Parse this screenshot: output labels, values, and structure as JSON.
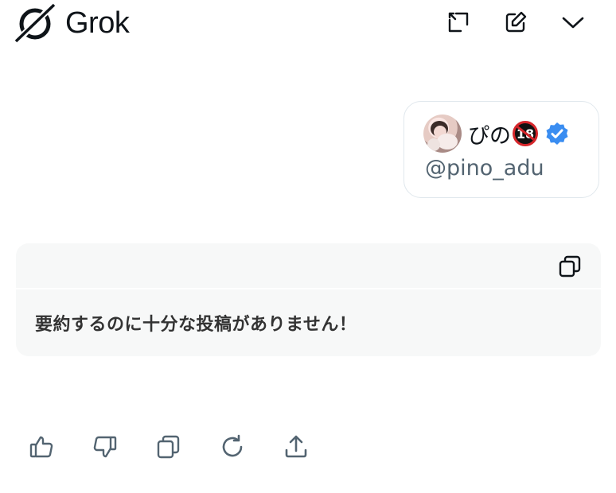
{
  "header": {
    "app_name": "Grok",
    "buttons": [
      {
        "name": "expand",
        "icon": "expand-icon"
      },
      {
        "name": "new-chat",
        "icon": "edit-icon"
      },
      {
        "name": "collapse",
        "icon": "chevron-down-icon"
      }
    ]
  },
  "user_card": {
    "display_name": "ぴの",
    "age_badge": "18",
    "handle": "@pino_adu",
    "verified": true,
    "verified_color": "#3a8df1"
  },
  "response": {
    "text": "要約するのに十分な投稿がありません！"
  },
  "actions": [
    {
      "name": "like",
      "icon": "thumbs-up-icon"
    },
    {
      "name": "dislike",
      "icon": "thumbs-down-icon"
    },
    {
      "name": "copy",
      "icon": "copy-icon"
    },
    {
      "name": "regenerate",
      "icon": "refresh-icon"
    },
    {
      "name": "share",
      "icon": "share-icon"
    }
  ],
  "colors": {
    "text": "#0f1419",
    "muted": "#536471",
    "panel": "#f7f8f8"
  }
}
